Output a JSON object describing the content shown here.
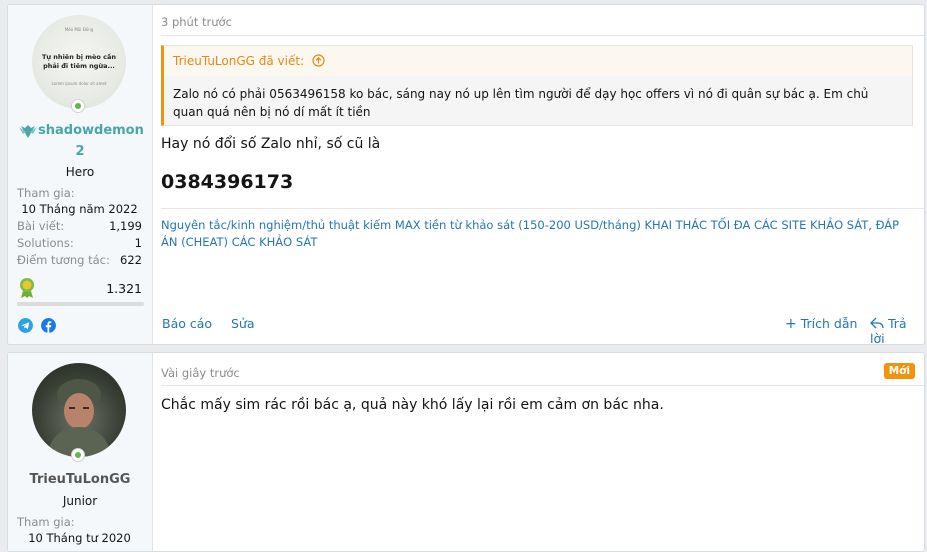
{
  "posts": [
    {
      "user": {
        "avatar_text_small": "Mèo Mũi Đồng",
        "avatar_text": "Tự nhiên bị mèo cần phải đi tiêm ngừa...",
        "avatar_text_tiny": "Lorem ipsum dolor sit amet",
        "name": "shadowdemon2",
        "title": "Hero",
        "joined_label": "Tham gia:",
        "joined_value": "10 Tháng năm 2022",
        "posts_label": "Bài viết:",
        "posts_value": "1,199",
        "solutions_label": "Solutions:",
        "solutions_value": "1",
        "points_label": "Điểm tương tác:",
        "points_value": "622",
        "rank_value": "1.321",
        "rank_fraction": 1.0
      },
      "time": "3 phút trước",
      "quote": {
        "author_line": "TrieuTuLonGG đã viết:",
        "body": "Zalo nó có phải 0563496158 ko bác, sáng nay nó up lên tìm người để dạy học offers vì nó đi quân sự bác ạ. Em chủ quan quá nên bị nó dí mất ít tiền"
      },
      "message": "Hay nó đổi số Zalo nhỉ, số cũ là",
      "phone": "0384396173",
      "signature": "Nguyên tắc/kinh nghiệm/thủ thuật kiếm MAX tiền từ khảo sát (150-200 USD/tháng) KHAI THÁC TỐI ĐA CÁC SITE KHẢO SÁT, ĐÁP ÁN (CHEAT) CÁC KHẢO SÁT",
      "actions": {
        "report": "Báo cáo",
        "edit": "Sửa",
        "quote": "Trích dẫn",
        "reply": "Trả lời"
      }
    },
    {
      "user": {
        "name": "TrieuTuLonGG",
        "title": "Junior",
        "joined_label": "Tham gia:",
        "joined_value": "10 Tháng tư 2020"
      },
      "time": "Vài giây trước",
      "badge": "Mới",
      "message": "Chắc mấy sim rác rồi bác ạ, quả này khó lấy lại rồi em cảm ơn bác nha."
    }
  ],
  "colors": {
    "link": "#2577b1",
    "accent": "#f2930d",
    "username1": "#47a7a5",
    "online": "#63b64a"
  },
  "icons": [
    "online-icon",
    "wings-badge-icon",
    "rank-medal-icon",
    "telegram-icon",
    "facebook-icon",
    "arrow-up-circle-icon",
    "plus-icon",
    "reply-icon"
  ]
}
